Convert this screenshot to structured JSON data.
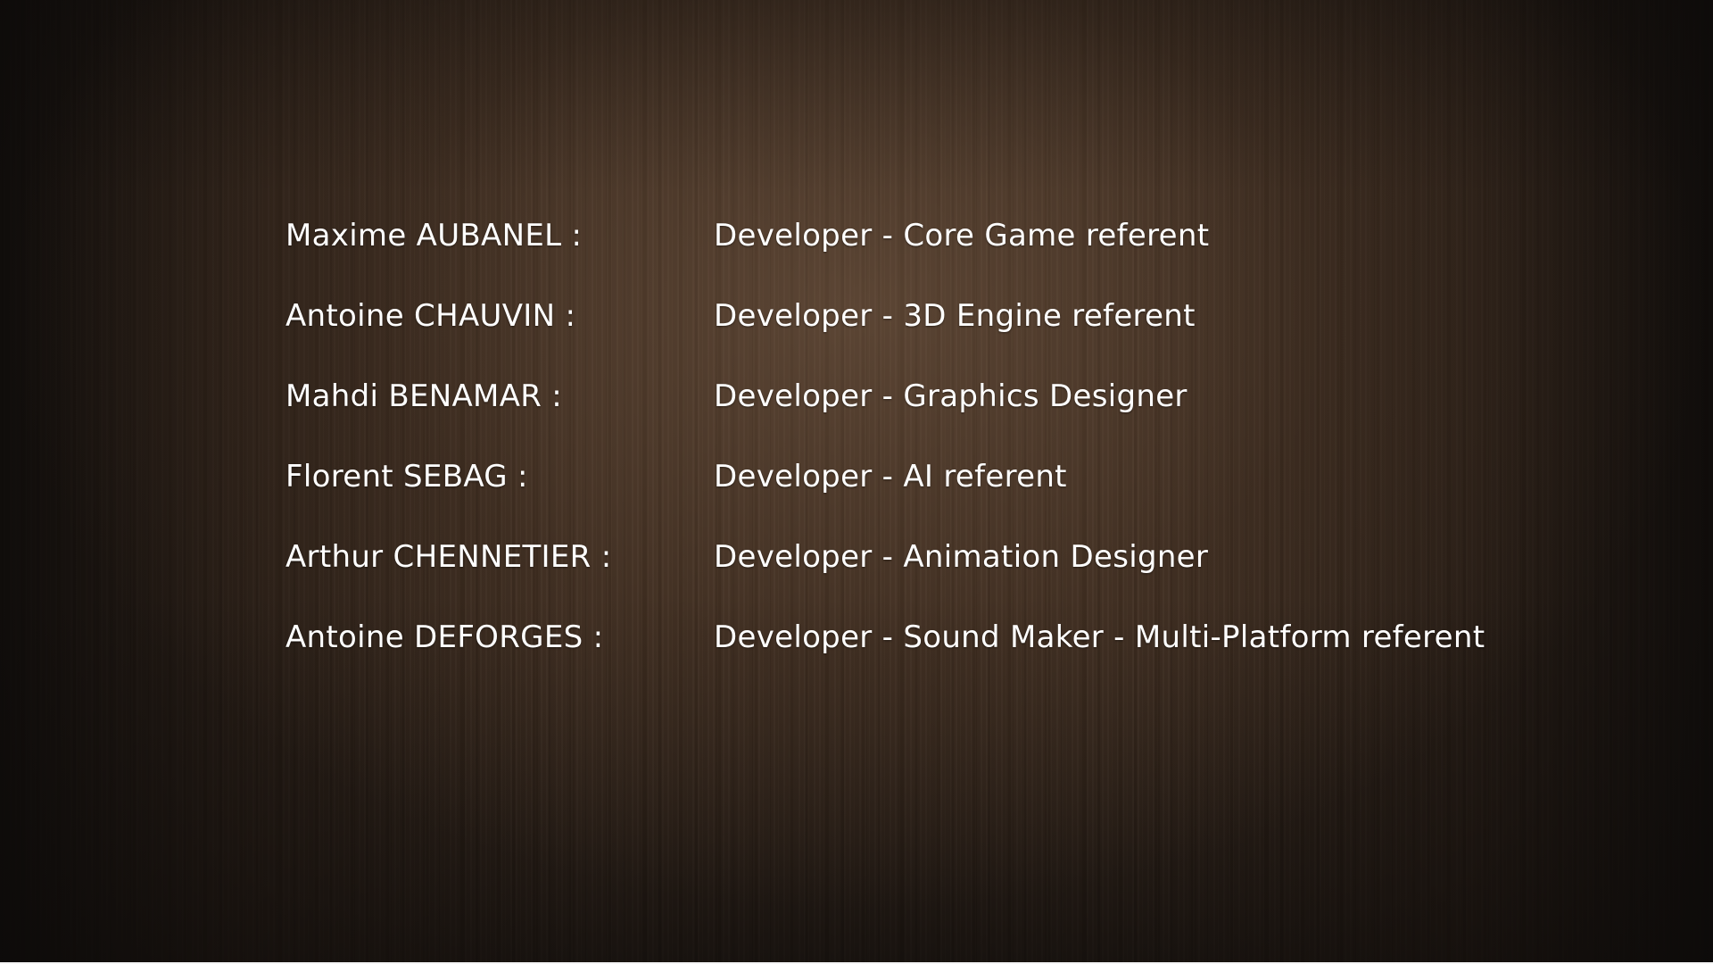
{
  "credits": [
    {
      "name": "Maxime AUBANEL :",
      "role": "Developer - Core Game referent"
    },
    {
      "name": "Antoine CHAUVIN :",
      "role": "Developer - 3D Engine referent"
    },
    {
      "name": "Mahdi BENAMAR :",
      "role": "Developer - Graphics Designer"
    },
    {
      "name": "Florent SEBAG :",
      "role": "Developer - AI referent"
    },
    {
      "name": "Arthur CHENNETIER :",
      "role": "Developer - Animation Designer"
    },
    {
      "name": "Antoine DEFORGES :",
      "role": "Developer - Sound Maker - Multi-Platform referent"
    }
  ],
  "colors": {
    "text": "#ffffff",
    "background": "#3a2a1e"
  }
}
